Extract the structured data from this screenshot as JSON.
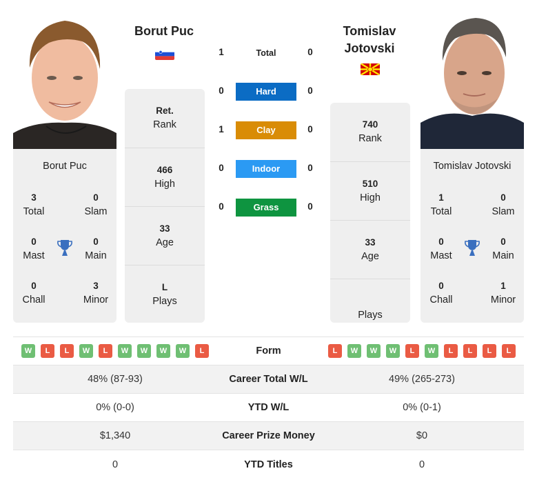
{
  "player_left": {
    "name": "Borut Puc",
    "card_name": "Borut Puc",
    "country_flag": "slovenia-flag",
    "titles": {
      "total": {
        "value": "3",
        "label": "Total"
      },
      "slam": {
        "value": "0",
        "label": "Slam"
      },
      "mast": {
        "value": "0",
        "label": "Mast"
      },
      "main": {
        "value": "0",
        "label": "Main"
      },
      "chall": {
        "value": "0",
        "label": "Chall"
      },
      "minor": {
        "value": "3",
        "label": "Minor"
      }
    },
    "ranking": {
      "rank": {
        "value": "Ret.",
        "label": "Rank"
      },
      "high": {
        "value": "466",
        "label": "High"
      },
      "age": {
        "value": "33",
        "label": "Age"
      },
      "plays": {
        "value": "L",
        "label": "Plays"
      }
    }
  },
  "player_right": {
    "name_line1": "Tomislav",
    "name_line2": "Jotovski",
    "card_name": "Tomislav Jotovski",
    "country_flag": "north-macedonia-flag",
    "titles": {
      "total": {
        "value": "1",
        "label": "Total"
      },
      "slam": {
        "value": "0",
        "label": "Slam"
      },
      "mast": {
        "value": "0",
        "label": "Mast"
      },
      "main": {
        "value": "0",
        "label": "Main"
      },
      "chall": {
        "value": "0",
        "label": "Chall"
      },
      "minor": {
        "value": "1",
        "label": "Minor"
      }
    },
    "ranking": {
      "rank": {
        "value": "740",
        "label": "Rank"
      },
      "high": {
        "value": "510",
        "label": "High"
      },
      "age": {
        "value": "33",
        "label": "Age"
      },
      "plays": {
        "value": "",
        "label": "Plays"
      }
    }
  },
  "h2h": [
    {
      "label": "Total",
      "left": "1",
      "right": "0",
      "color": ""
    },
    {
      "label": "Hard",
      "left": "0",
      "right": "0",
      "color": "#0b6cc4"
    },
    {
      "label": "Clay",
      "left": "1",
      "right": "0",
      "color": "#d98c06"
    },
    {
      "label": "Indoor",
      "left": "0",
      "right": "0",
      "color": "#2b9af3"
    },
    {
      "label": "Grass",
      "left": "0",
      "right": "0",
      "color": "#0e9440"
    }
  ],
  "form": {
    "label": "Form",
    "left": [
      "W",
      "L",
      "L",
      "W",
      "L",
      "W",
      "W",
      "W",
      "W",
      "L"
    ],
    "right": [
      "L",
      "W",
      "W",
      "W",
      "L",
      "W",
      "L",
      "L",
      "L",
      "L"
    ]
  },
  "stats": [
    {
      "label": "Career Total W/L",
      "left": "48% (87-93)",
      "right": "49% (265-273)"
    },
    {
      "label": "YTD W/L",
      "left": "0% (0-0)",
      "right": "0% (0-1)"
    },
    {
      "label": "Career Prize Money",
      "left": "$1,340",
      "right": "$0"
    },
    {
      "label": "YTD Titles",
      "left": "0",
      "right": "0"
    }
  ],
  "colors": {
    "win": "#6fbf73",
    "loss": "#ea5b44",
    "trophy": "#3a6fbf",
    "card_bg": "#efefef"
  }
}
